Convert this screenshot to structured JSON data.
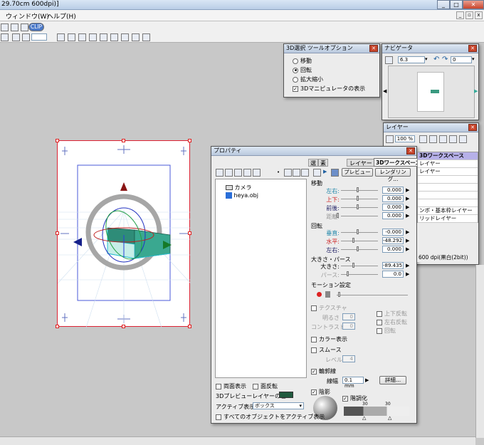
{
  "window": {
    "title": "29.70cm 600dpi)]"
  },
  "menu": {
    "window": "ウィンドウ(W)",
    "help": "ヘルプ(H)"
  },
  "toolbar": {
    "clip_label": "CLIP"
  },
  "tool_options": {
    "title": "3D選択 ツールオプション",
    "options": [
      {
        "label": "移動",
        "selected": false
      },
      {
        "label": "回転",
        "selected": true
      },
      {
        "label": "拡大縮小",
        "selected": false
      }
    ],
    "manipulator_label": "3Dマニピュレータの表示",
    "manipulator_checked": true
  },
  "navigator": {
    "title": "ナビゲータ",
    "zoom": "6.3",
    "rotation": "0"
  },
  "layer": {
    "title": "レイヤー",
    "zoom": "100 %",
    "items": [
      "3Dワークスペース",
      "レイヤー",
      "レイヤー",
      "",
      "",
      "",
      "",
      "ンボ・基本枠レイヤー",
      "リッドレイヤー"
    ],
    "status": "600 dpi(黒白(2bit))"
  },
  "properties": {
    "title": "プロパティ",
    "tabs": [
      "選",
      "素",
      "レイヤー",
      "3Dワークスペース"
    ],
    "preview_button": "プレビュー",
    "rendering_button": "レンダリング...",
    "tree": {
      "camera": "カメラ",
      "object": "heya.obj"
    },
    "move": {
      "section": "移動",
      "rows": [
        {
          "label": "左右:",
          "value": "0.000"
        },
        {
          "label": "上下:",
          "value": "0.000"
        },
        {
          "label": "前後:",
          "value": "0.000"
        },
        {
          "label": "距離:",
          "value": "0.000"
        }
      ]
    },
    "rotate": {
      "section": "回転",
      "rows": [
        {
          "label": "垂直:",
          "value": "-0.000"
        },
        {
          "label": "水平:",
          "value": "-48.292"
        },
        {
          "label": "左右:",
          "value": "0.000"
        }
      ]
    },
    "size_perspective": {
      "section": "大きさ・パース",
      "size_label": "大きさ:",
      "size_value": "-89.435",
      "perspective_label": "パース:",
      "perspective_value": "0.0"
    },
    "motion": {
      "section": "モーション設定"
    },
    "texture": {
      "label": "テクスチャ",
      "brightness_label": "明るさ",
      "brightness_value": "0",
      "contrast_label": "コントラスト",
      "contrast_value": "0",
      "flip_v": "上下反転",
      "flip_h": "左右反転",
      "rotate": "回転"
    },
    "color_display": "カラー表示",
    "smooth": {
      "label": "スムース",
      "level_label": "レベル",
      "level_value": "4"
    },
    "outline": {
      "label": "輪郭線",
      "width_label": "線幅",
      "width_value": "0.1 mm",
      "detail_button": "詳細..."
    },
    "shadow": {
      "label": "陰影",
      "tone_label": "階調化",
      "tick1": "30",
      "tick2": "30"
    },
    "bottom": {
      "both_sides": "両面表示",
      "invert_faces": "面反転",
      "preview_color_label": "3Dプレビューレイヤーの色:",
      "active_label": "アクティブ表示:",
      "active_value": "ボックス",
      "all_active": "すべてのオブジェクトをアクティブ表示"
    }
  },
  "colors": {
    "accent_red": "#d22233",
    "preview_layer_color": "#205a3e",
    "selection_blue": "#2b3fd8"
  }
}
